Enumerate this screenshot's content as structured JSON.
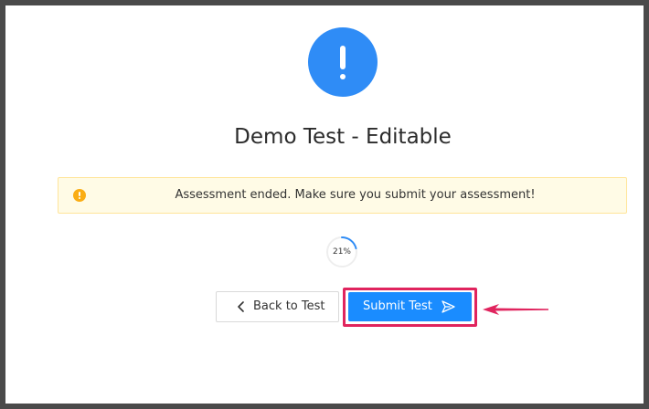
{
  "page": {
    "title": "Demo Test - Editable"
  },
  "banner": {
    "message": "Assessment ended. Make sure you submit your assessment!"
  },
  "progress": {
    "value": 0.21,
    "label": "21%"
  },
  "actions": {
    "back_label": "Back to Test",
    "submit_label": "Submit Test"
  },
  "icons": {
    "status": "exclamation-icon",
    "banner": "warning-icon",
    "back": "chevron-left-icon",
    "submit": "send-icon",
    "annotation": "arrow-left-icon"
  },
  "colors": {
    "primary": "#1a8cff",
    "status_circle": "#2f8cf6",
    "banner_bg": "#fffbe6",
    "banner_border": "#ffe59a",
    "warning": "#faad14",
    "annotation": "#e0245e"
  }
}
